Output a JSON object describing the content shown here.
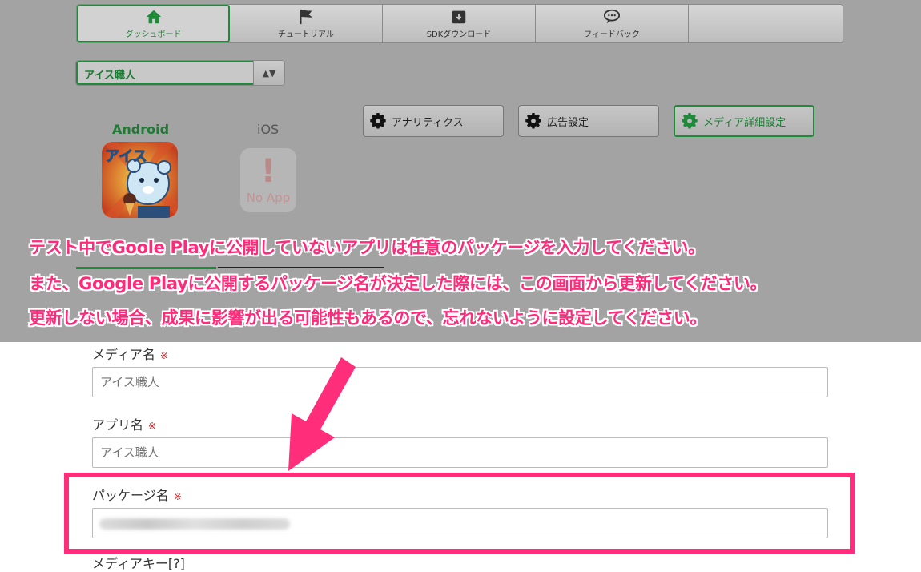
{
  "nav": {
    "items": [
      {
        "label": "ダッシュボード",
        "icon": "home-icon",
        "active": true
      },
      {
        "label": "チュートリアル",
        "icon": "flag-icon"
      },
      {
        "label": "SDKダウンロード",
        "icon": "download-box-icon"
      },
      {
        "label": "フィードバック",
        "icon": "speech-bubble-icon"
      },
      {
        "label": ""
      }
    ]
  },
  "app_select": {
    "value": "アイス職人",
    "arrows": "▲▼"
  },
  "buttons": {
    "analytics": "アナリティクス",
    "ad_settings": "広告設定",
    "media_settings": "メディア詳細設定"
  },
  "platforms": {
    "android": "Android",
    "ios": "iOS",
    "no_app": "No App",
    "app_icon_text": "アイス"
  },
  "annotation": {
    "line1": "テスト中でGoole Playに公開していないアプリは任意のパッケージを入力してください。",
    "line2": "また、Google Playに公開するパッケージ名が決定した際には、この画面から更新してください。",
    "line3": "更新しない場合、成果に影響が出る可能性もあるので、忘れないように設定してください。"
  },
  "form": {
    "media_name_label": "メディア名",
    "media_name_value": "アイス職人",
    "app_name_label": "アプリ名",
    "app_name_value": "アイス職人",
    "package_label": "パッケージ名",
    "media_key_label": "メディアキー[?]",
    "required_mark": "※"
  },
  "colors": {
    "accent_green": "#1f8a3a",
    "annotation_pink": "#ff2a7a",
    "required_red": "#d32020"
  }
}
